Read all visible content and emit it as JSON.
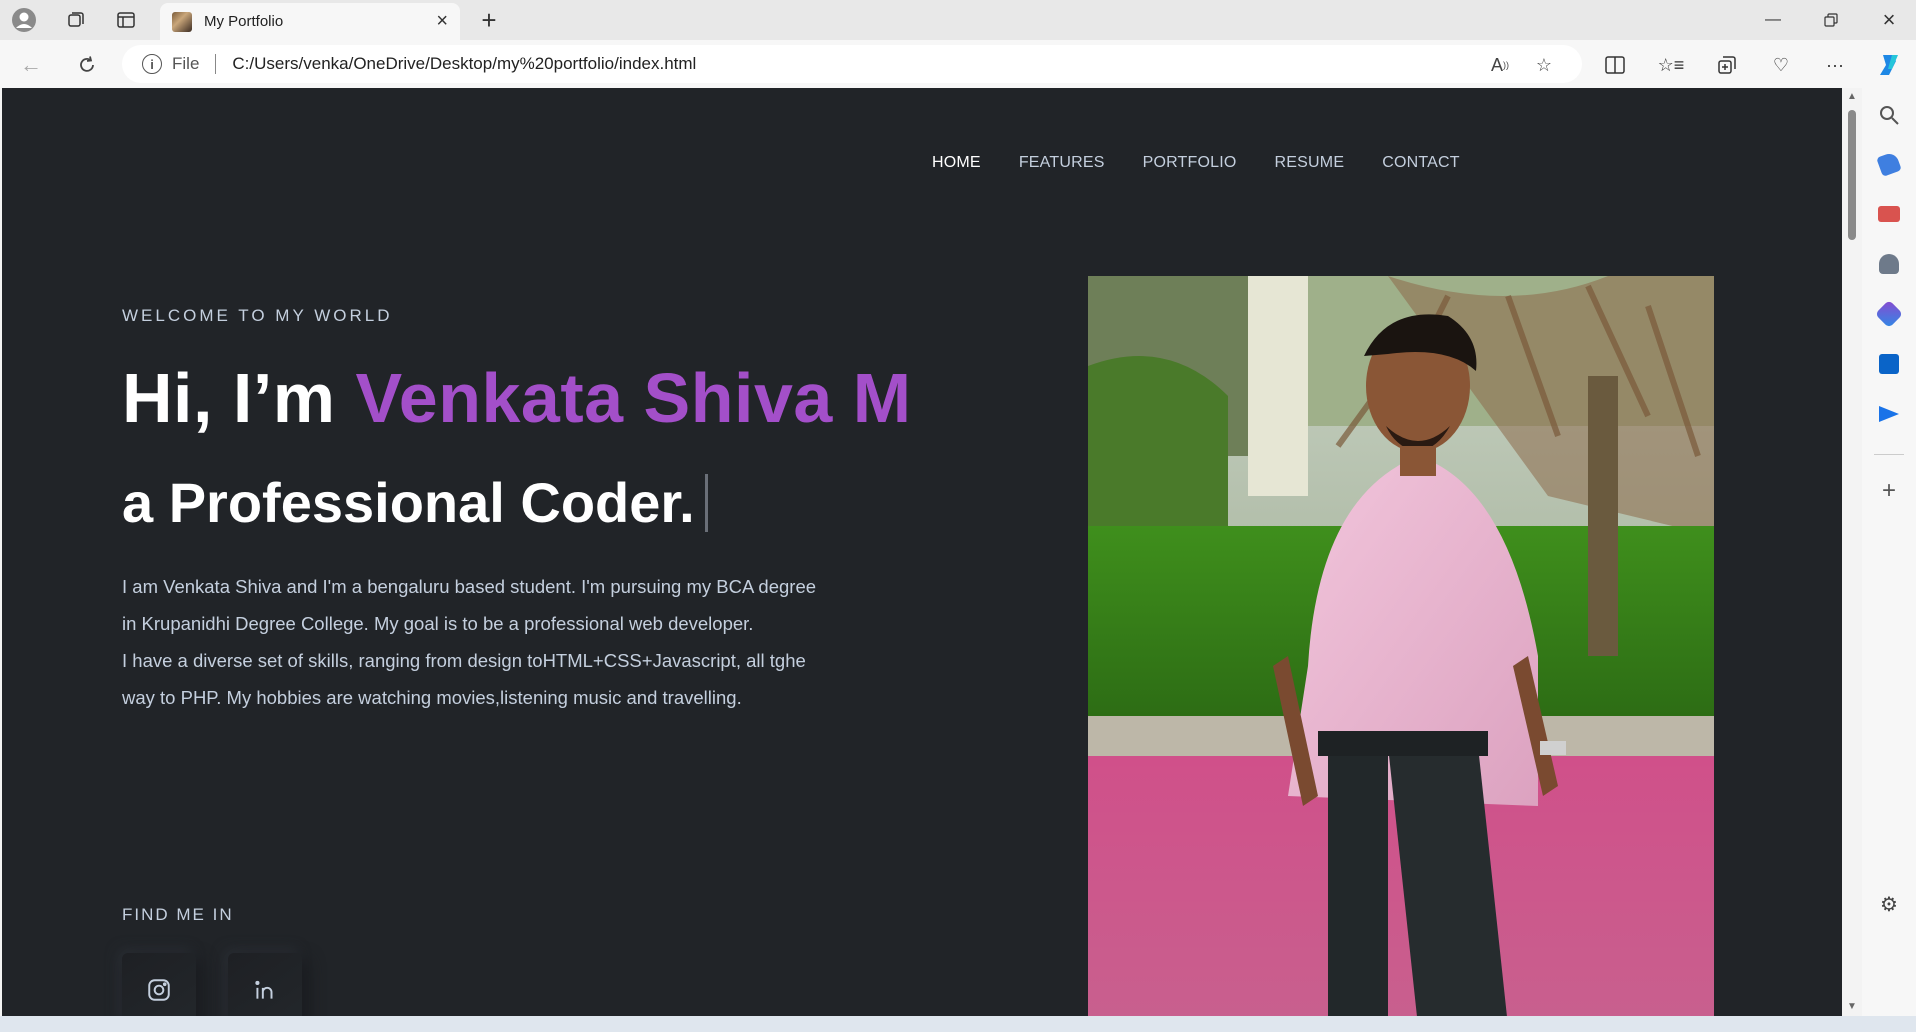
{
  "browser": {
    "tab_title": "My Portfolio",
    "omnibox_file_label": "File",
    "url": "C:/Users/venka/OneDrive/Desktop/my%20portfolio/index.html"
  },
  "nav": {
    "items": [
      "HOME",
      "FEATURES",
      "PORTFOLIO",
      "RESUME",
      "CONTACT"
    ],
    "active": "HOME"
  },
  "hero": {
    "welcome": "WELCOME TO MY WORLD",
    "greeting": "Hi, I’m ",
    "name": "Venkata Shiva M",
    "role": "a Professional Coder.",
    "description_lines": [
      "I am Venkata Shiva and I'm a bengaluru based student. I'm pursuing my BCA degree",
      "in Krupanidhi Degree College. My goal is to be a professional web developer.",
      "I have a diverse set of skills, ranging from design toHTML+CSS+Javascript, all tghe",
      "way to PHP. My hobbies are watching movies,listening music and travelling."
    ],
    "find_me": "FIND ME IN"
  },
  "social": [
    "instagram-icon",
    "linkedin-icon"
  ],
  "colors": {
    "background": "#212428",
    "accent": "#a34fc9",
    "text": "#c4cfde"
  }
}
